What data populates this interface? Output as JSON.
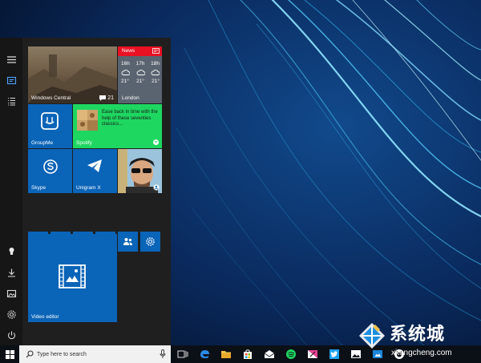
{
  "tiles": {
    "windows_central": {
      "label": "Windows Central",
      "count": "21"
    },
    "news": {
      "title": "News",
      "times": [
        "16h",
        "17h",
        "18h"
      ],
      "temps": [
        "21°",
        "21°",
        "21°"
      ],
      "city": "London"
    },
    "groupme": {
      "label": "GroupMe"
    },
    "spotify": {
      "label": "Spotify",
      "text": "Ease back in time with the help of these seventies classics..."
    },
    "skype": {
      "label": "Skype"
    },
    "unigram": {
      "label": "Unigram X"
    },
    "video_editor": {
      "label": "Video editor"
    }
  },
  "taskbar": {
    "search_placeholder": "Type here to search"
  },
  "watermark": {
    "brand": "系统城",
    "site": "xitongcheng.com"
  },
  "colors": {
    "tile_blue": "#0a64b8",
    "spotify_green": "#1ed760",
    "news_red": "#e81123"
  }
}
